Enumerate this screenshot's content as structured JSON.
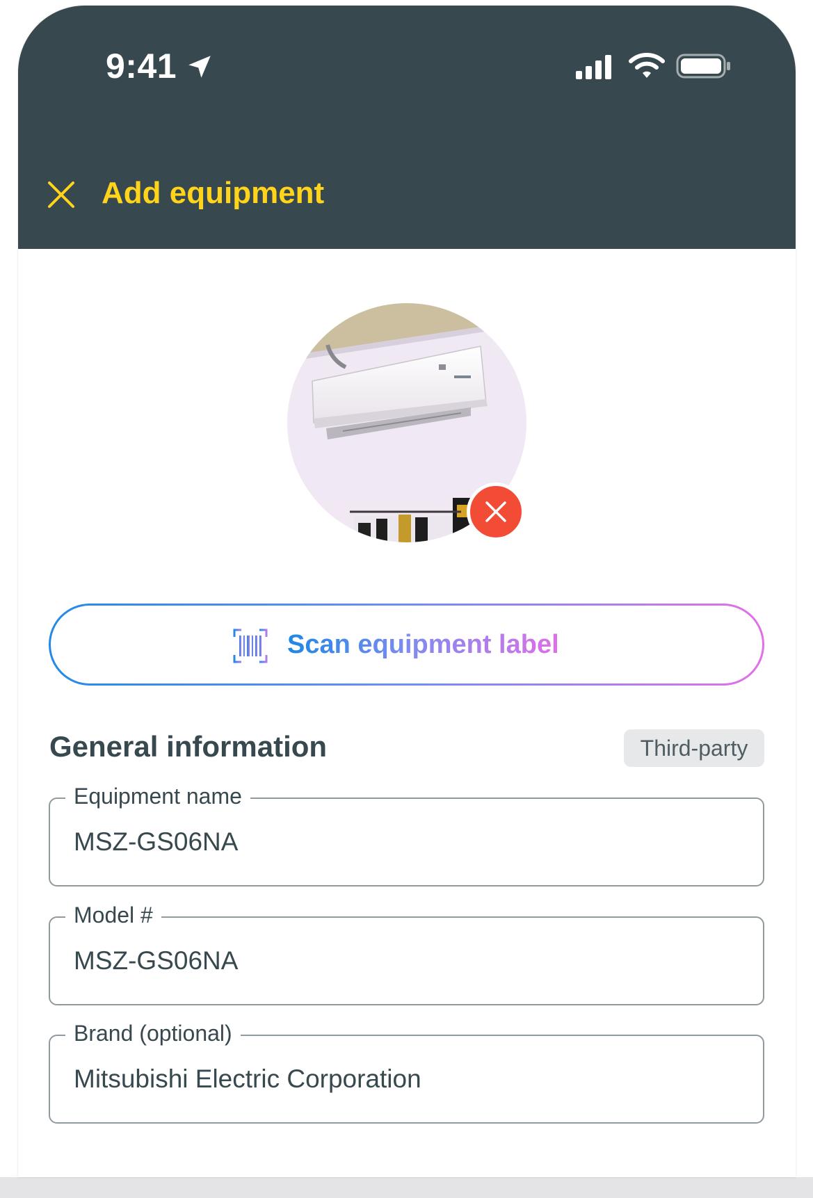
{
  "status_bar": {
    "time": "9:41"
  },
  "header": {
    "title": "Add equipment",
    "close_icon": "close-icon"
  },
  "photo": {
    "alt": "Wall-mounted mini split air conditioner",
    "remove_icon": "remove-photo-icon"
  },
  "scan": {
    "label": "Scan equipment label",
    "icon": "barcode-scan-icon"
  },
  "section": {
    "title": "General information",
    "badge": "Third-party"
  },
  "fields": [
    {
      "label": "Equipment name",
      "value": "MSZ-GS06NA"
    },
    {
      "label": "Model #",
      "value": "MSZ-GS06NA"
    },
    {
      "label": "Brand (optional)",
      "value": "Mitsubishi Electric Corporation"
    }
  ],
  "colors": {
    "header_bg": "#37494f",
    "title_accent": "#ffd41a",
    "remove_red": "#f24b36",
    "gradient_start": "#2389e8",
    "gradient_end": "#e270e6",
    "text_dark": "#37494f"
  }
}
